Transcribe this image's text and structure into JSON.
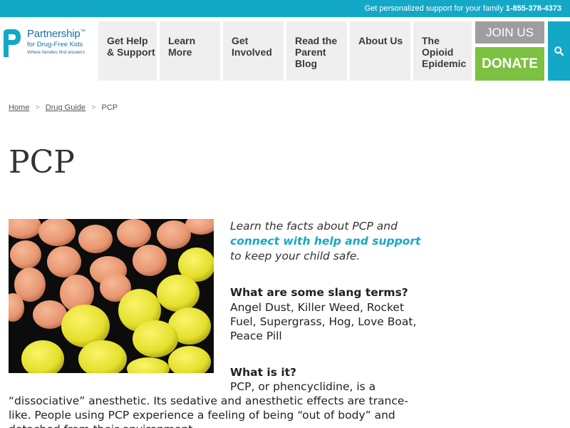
{
  "topbar": {
    "text": "Get personalized support for your family",
    "phone": "1-855-378-4373"
  },
  "logo": {
    "name": "Partnership",
    "trademark": "™",
    "sub": "for Drug-Free Kids",
    "tagline": "Where families find answers"
  },
  "nav": {
    "items": [
      {
        "label": "Get Help & Support"
      },
      {
        "label": "Learn More"
      },
      {
        "label": "Get Involved"
      },
      {
        "label": "Read the Parent Blog"
      },
      {
        "label": "About Us"
      },
      {
        "label": "The Opioid Epidemic"
      }
    ],
    "join_label": "JOIN US",
    "donate_label": "DONATE"
  },
  "breadcrumb": {
    "home": "Home",
    "guide": "Drug Guide",
    "current": "PCP",
    "separator": ">"
  },
  "page": {
    "title": "PCP",
    "intro_prefix": "Learn the facts about PCP and",
    "intro_link": "connect with help and support",
    "intro_suffix": "to keep your child safe.",
    "q1": "What are some slang terms?",
    "a1": "Angel Dust, Killer Weed, Rocket Fuel, Supergrass, Hog, Love Boat, Peace Pill",
    "q2": "What is it?",
    "a2": "PCP, or phencyclidine, is a “dissociative” anesthetic. Its sedative and anesthetic effects are trance-like. People using PCP experience a feeling of being “out of body” and detached from their environment."
  },
  "colors": {
    "brand": "#14a8c7",
    "donate": "#7cc142",
    "join": "#9e9e9e",
    "nav_bg": "#efefef"
  },
  "icons": {
    "search": "search-icon",
    "logo": "partnership-p-logo-icon"
  }
}
